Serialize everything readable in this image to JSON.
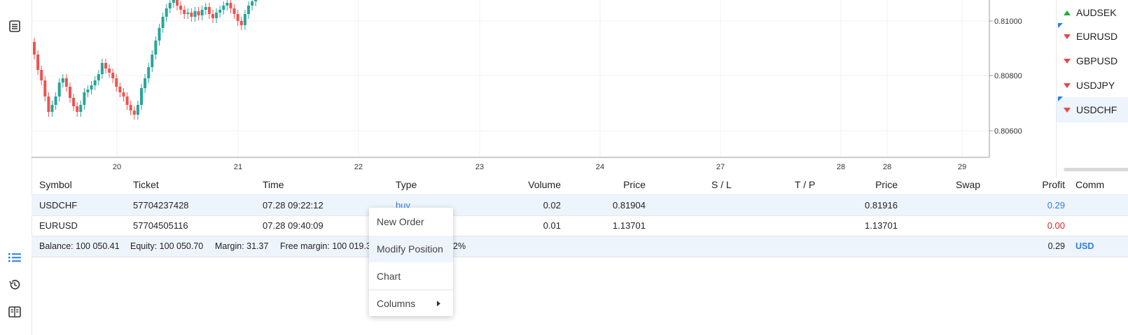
{
  "sidebar": {
    "icons": [
      "document-icon",
      "list-icon",
      "history-icon",
      "journal-icon"
    ]
  },
  "chart": {
    "symbol": "USDCHF",
    "y_ticks": [
      "0.81000",
      "0.80800",
      "0.80600"
    ],
    "x_ticks": [
      "20",
      "21",
      "22",
      "23",
      "24",
      "27",
      "28",
      "28",
      "29"
    ],
    "colors": {
      "up": "#26a69a",
      "down": "#ef5350",
      "grid": "#f2f2f2",
      "axis": "#999999"
    }
  },
  "watchlist": {
    "items": [
      {
        "symbol": "AUDSEK",
        "direction": "up"
      },
      {
        "symbol": "EURUSD",
        "direction": "down"
      },
      {
        "symbol": "GBPUSD",
        "direction": "down"
      },
      {
        "symbol": "USDJPY",
        "direction": "down"
      },
      {
        "symbol": "USDCHF",
        "direction": "down",
        "selected": true
      }
    ]
  },
  "positions": {
    "headers": {
      "symbol": "Symbol",
      "ticket": "Ticket",
      "time": "Time",
      "type": "Type",
      "volume": "Volume",
      "price": "Price",
      "sl": "S / L",
      "tp": "T / P",
      "cur_price": "Price",
      "swap": "Swap",
      "profit": "Profit",
      "comment": "Comm"
    },
    "rows": [
      {
        "symbol": "USDCHF",
        "ticket": "57704237428",
        "time": "07.28 09:22:12",
        "type": "buy",
        "volume": "0.02",
        "price": "0.81904",
        "cur_price": "0.81916",
        "profit": "0.29"
      },
      {
        "symbol": "EURUSD",
        "ticket": "57704505116",
        "time": "07.28 09:40:09",
        "type": "",
        "volume": "0.01",
        "price": "1.13701",
        "cur_price": "1.13701",
        "profit": "0.00"
      }
    ],
    "summary": {
      "balance": "Balance: 100 050.41",
      "equity": "Equity: 100 050.70",
      "margin": "Margin: 31.37",
      "free_margin": "Free margin: 100 019.3",
      "margin_level_fragment": "2%",
      "profit": "0.29",
      "currency": "USD"
    }
  },
  "context_menu": {
    "items": [
      "New Order",
      "Modify Position",
      "Chart",
      "Columns"
    ],
    "highlighted": "Modify Position"
  },
  "colors": {
    "accent": "#2e7ce4",
    "loss": "#e02424",
    "gain": "#1fab3e",
    "selected_bg": "#eef4fb"
  }
}
